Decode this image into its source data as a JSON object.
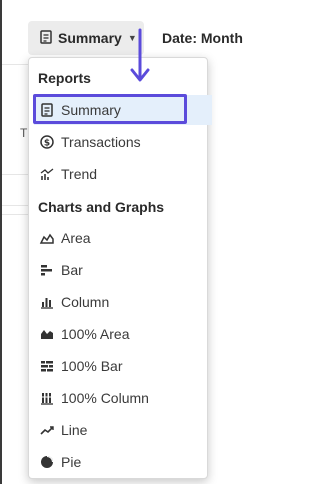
{
  "toolbar": {
    "view_label": "Summary",
    "date_label": "Date: Month"
  },
  "background_letter": "T",
  "menu": {
    "reports_header": "Reports",
    "reports": [
      {
        "label": "Summary",
        "icon": "document-icon",
        "selected": true
      },
      {
        "label": "Transactions",
        "icon": "exchange-icon"
      },
      {
        "label": "Trend",
        "icon": "trend-icon"
      }
    ],
    "charts_header": "Charts and Graphs",
    "charts": [
      {
        "label": "Area",
        "icon": "area-chart-icon"
      },
      {
        "label": "Bar",
        "icon": "bar-chart-icon"
      },
      {
        "label": "Column",
        "icon": "column-chart-icon"
      },
      {
        "label": "100% Area",
        "icon": "stacked-area-icon"
      },
      {
        "label": "100% Bar",
        "icon": "stacked-bar-icon"
      },
      {
        "label": "100% Column",
        "icon": "stacked-column-icon"
      },
      {
        "label": "Line",
        "icon": "line-chart-icon"
      },
      {
        "label": "Pie",
        "icon": "pie-chart-icon"
      }
    ]
  },
  "colors": {
    "highlight": "#5b4bdb",
    "selected_bg": "#e4effb",
    "button_bg": "#ececec"
  }
}
